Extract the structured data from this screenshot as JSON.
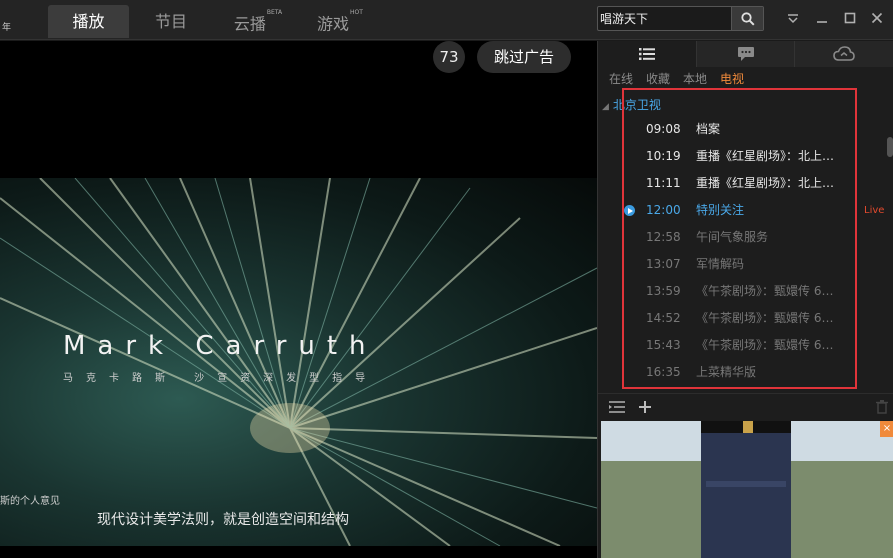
{
  "header": {
    "logo_fragment": "年",
    "tabs": [
      {
        "label": "播放",
        "sup": "",
        "active": true
      },
      {
        "label": "节目",
        "sup": "",
        "active": false
      },
      {
        "label": "云播",
        "sup": "BETA",
        "active": false
      },
      {
        "label": "游戏",
        "sup": "HOT",
        "active": false
      }
    ],
    "search": {
      "value": "唱游天下",
      "placeholder": ""
    }
  },
  "player": {
    "countdown": "73",
    "skip_label": "跳过广告",
    "ad_title": "Mark Carruth",
    "ad_subtitle": "马克卡路斯 沙宣资深发型指导",
    "ad_note": "斯的个人意见",
    "ad_caption": "现代设计美学法则，就是创造空间和结构"
  },
  "panel": {
    "tabs": [
      {
        "icon": "list-icon",
        "active": true
      },
      {
        "icon": "chat-icon",
        "active": false
      },
      {
        "icon": "cloud-icon",
        "active": false
      }
    ],
    "subtabs": [
      {
        "label": "在线",
        "active": false
      },
      {
        "label": "收藏",
        "active": false
      },
      {
        "label": "本地",
        "active": false
      },
      {
        "label": "电视",
        "active": true
      }
    ],
    "channel": "北京卫视",
    "programs": [
      {
        "time": "09:08",
        "name": "档案",
        "state": "past"
      },
      {
        "time": "10:19",
        "name": "重播《红星剧场》：北上…",
        "state": "past"
      },
      {
        "time": "11:11",
        "name": "重播《红星剧场》：北上…",
        "state": "past"
      },
      {
        "time": "12:00",
        "name": "特别关注",
        "state": "now",
        "badge": "Live"
      },
      {
        "time": "12:58",
        "name": "午间气象服务",
        "state": "future"
      },
      {
        "time": "13:07",
        "name": "军情解码",
        "state": "future"
      },
      {
        "time": "13:59",
        "name": "《午茶剧场》：甄嬛传 6…",
        "state": "future"
      },
      {
        "time": "14:52",
        "name": "《午茶剧场》：甄嬛传 6…",
        "state": "future"
      },
      {
        "time": "15:43",
        "name": "《午茶剧场》：甄嬛传 6…",
        "state": "future"
      },
      {
        "time": "16:35",
        "name": "上菜精华版",
        "state": "future"
      }
    ],
    "ad_close": "×"
  },
  "colors": {
    "accent": "#f08a3b",
    "link": "#4aa8e8",
    "live": "#e24a2e",
    "highlight": "#e0343a"
  }
}
